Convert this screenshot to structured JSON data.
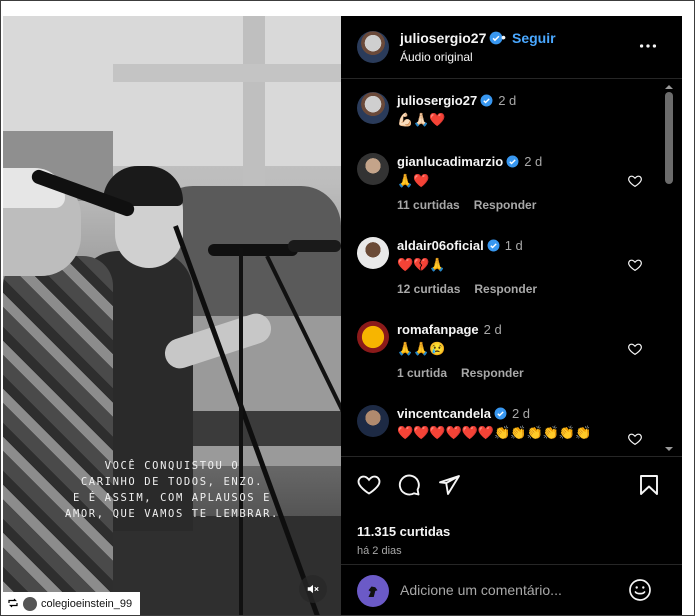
{
  "video": {
    "caption_lines": [
      "VOCÊ CONQUISTOU O",
      "CARINHO DE TODOS, ENZO.",
      "E É ASSIM, COM APLAUSOS E",
      "AMOR, QUE VAMOS TE LEMBRAR."
    ],
    "repost_user": "colegioeinstein_99"
  },
  "post_header": {
    "username": "juliosergio27",
    "dot": "•",
    "follow_label": "Seguir",
    "audio_label": "Áudio original"
  },
  "comments": [
    {
      "username": "juliosergio27",
      "time": "2 d",
      "text": "💪🏻🙏🏻❤️",
      "likes": "",
      "reply": ""
    },
    {
      "username": "gianlucadimarzio",
      "time": "2 d",
      "text": "🙏❤️",
      "likes": "11 curtidas",
      "reply": "Responder"
    },
    {
      "username": "aldair06oficial",
      "time": "1 d",
      "text": "❤️💔🙏",
      "likes": "12 curtidas",
      "reply": "Responder"
    },
    {
      "username": "romafanpage",
      "time": "2 d",
      "text": "🙏🙏😢",
      "likes": "1 curtida",
      "reply": "Responder"
    },
    {
      "username": "vincentcandela",
      "time": "2 d",
      "text": "❤️❤️❤️❤️❤️❤️👏👏👏👏👏👏",
      "likes": "",
      "reply": ""
    }
  ],
  "actions": {
    "likes": "11.315 curtidas",
    "time": "há 2 dias"
  },
  "comment_bar": {
    "placeholder": "Adicione um comentário..."
  },
  "colors": {
    "panel_bg": "#000000",
    "link_blue": "#4aa8ff",
    "verified_blue": "#3897f0",
    "muted_text": "#a8a8a8"
  },
  "icons": [
    "more-options-icon",
    "verified-badge-icon",
    "heart-icon",
    "comment-icon",
    "share-icon",
    "bookmark-icon",
    "emoji-icon",
    "mute-icon",
    "repost-icon"
  ]
}
